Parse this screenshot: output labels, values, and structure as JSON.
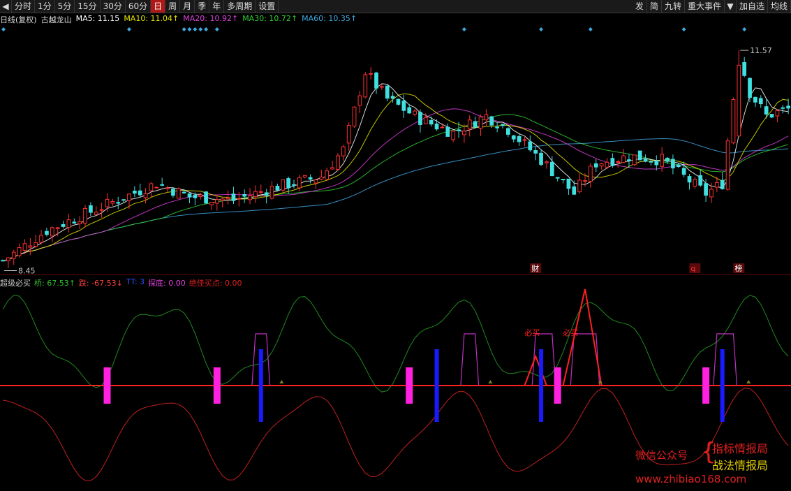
{
  "toolbar": {
    "left_buttons": [
      "分时",
      "1分",
      "5分",
      "15分",
      "30分",
      "60分",
      "日",
      "周",
      "月",
      "季",
      "年",
      "多周期",
      "设置"
    ],
    "active": "日",
    "right_buttons": [
      "发",
      "简",
      "九转",
      "重大事件",
      "加自选",
      "均线"
    ]
  },
  "legend": {
    "period": "日线(复权)",
    "name": "古越龙山",
    "ma5": "MA5: 11.15",
    "ma10": "MA10: 11.04↑",
    "ma20": "MA20: 10.92↑",
    "ma30": "MA30: 10.72↑",
    "ma60": "MA60: 10.35↑"
  },
  "indicator_legend": {
    "name": "超级必买",
    "qiao": "桥: 67.53↑",
    "die": "跌: -67.53↓",
    "tt": "TT: 3",
    "tandi": "探底: 0.00",
    "juejia": "绝佳买点: 0.00"
  },
  "colors": {
    "up": "#ff3030",
    "down": "#40e0e0",
    "ma5": "#ffffff",
    "ma10": "#e6e600",
    "ma20": "#e040e0",
    "ma30": "#30d030",
    "ma60": "#40a8e0",
    "zero": "#ff2020",
    "magenta": "#ff20e0",
    "blue": "#1a1aff"
  },
  "chart_data": {
    "type": "candlestick",
    "price_high_label": "11.57",
    "price_low_label": "8.45",
    "ylim": [
      8.3,
      11.85
    ],
    "n": 144,
    "markers": [
      "财",
      "q",
      "榜"
    ],
    "marker_idx": [
      97,
      126,
      134
    ],
    "diamond_idx": [
      0,
      23,
      33,
      34,
      35,
      36,
      37,
      39,
      84,
      98,
      107,
      124,
      135
    ],
    "indicator_labels": [
      "必买",
      "必买"
    ],
    "indicator_label_idx": [
      96,
      103
    ],
    "magenta_bar_idx": [
      19,
      39,
      74,
      101,
      128
    ],
    "blue_bar_idx": [
      47,
      79,
      98,
      131
    ]
  },
  "watermark": {
    "left": "微信公众号",
    "right1": "指标情报局",
    "right2": "战法情报局",
    "url": "www.zhibiao168.com"
  }
}
